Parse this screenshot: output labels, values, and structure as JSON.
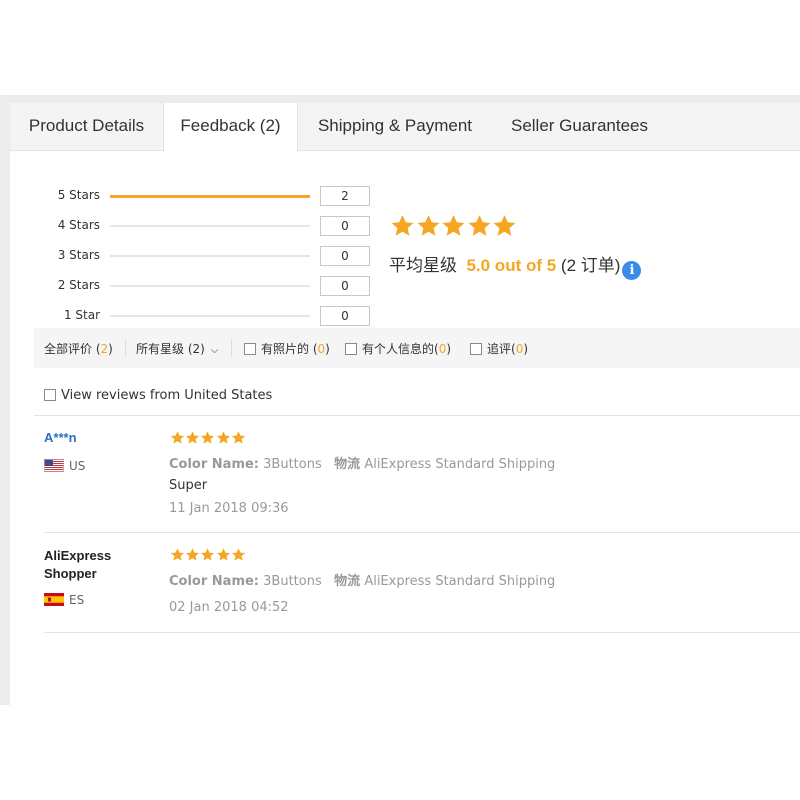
{
  "tabs": [
    {
      "label": "Product Details",
      "active": false
    },
    {
      "label": "Feedback (2)",
      "active": true
    },
    {
      "label": "Shipping & Payment",
      "active": false
    },
    {
      "label": "Seller Guarantees",
      "active": false
    }
  ],
  "rating_breakdown": [
    {
      "label": "5 Stars",
      "count": "2",
      "share": 1.0
    },
    {
      "label": "4 Stars",
      "count": "0",
      "share": 0.0
    },
    {
      "label": "3 Stars",
      "count": "0",
      "share": 0.0
    },
    {
      "label": "2 Stars",
      "count": "0",
      "share": 0.0
    },
    {
      "label": "1 Star",
      "count": "0",
      "share": 0.0
    }
  ],
  "summary": {
    "stars": 5,
    "avg_label": "平均星级",
    "avg_value": "5.0 out of 5",
    "orders": "(2 订单)",
    "info_icon": "info-icon"
  },
  "filters": {
    "all_label": "全部评价",
    "all_count": "2",
    "star_label": "所有星级 (2)",
    "photo_label": "有照片的",
    "photo_count": "0",
    "personal_label": "有个人信息的",
    "personal_count": "0",
    "followup_label": "追评",
    "followup_count": "0",
    "us_only_label": "View reviews from United States"
  },
  "reviews": [
    {
      "name": "A***n",
      "country": "US",
      "stars": 5,
      "color_key": "Color Name:",
      "color_val": "3Buttons",
      "ship_key": "物流",
      "ship_val": "AliExpress Standard Shipping",
      "text": "Super",
      "date": "11 Jan 2018 09:36"
    },
    {
      "name": "AliExpress Shopper",
      "country": "ES",
      "stars": 5,
      "color_key": "Color Name:",
      "color_val": "3Buttons",
      "ship_key": "物流",
      "ship_val": "AliExpress Standard Shipping",
      "text": "",
      "date": "02 Jan 2018 04:52"
    }
  ],
  "colors": {
    "accent": "#f5a623",
    "link": "#2d6fc0",
    "info": "#3c8ce7"
  }
}
